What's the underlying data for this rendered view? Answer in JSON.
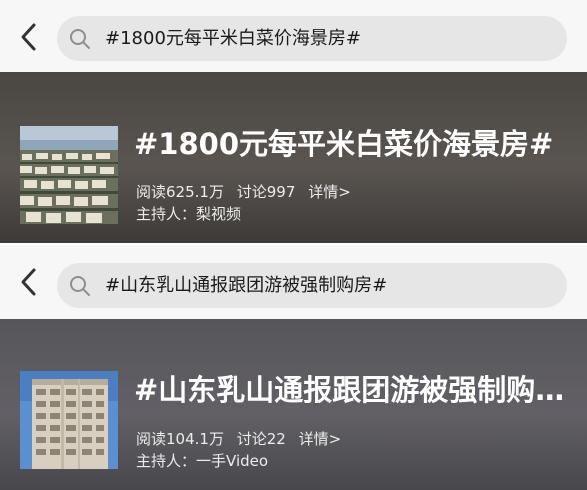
{
  "panels": [
    {
      "search_query": "#1800元每平米白菜价海景房#",
      "title": "#1800元每平米白菜价海景房#",
      "read_label": "阅读",
      "read_count": "625.1万",
      "discuss_label": "讨论",
      "discuss_count": "997",
      "detail_label": "详情>",
      "host_label": "主持人：",
      "host_name": "梨视频",
      "icons": {
        "back": "chevron-left-icon",
        "search": "search-icon"
      }
    },
    {
      "search_query": "#山东乳山通报跟团游被强制购房#",
      "title": "#山东乳山通报跟团游被强制购…",
      "read_label": "阅读",
      "read_count": "104.1万",
      "discuss_label": "讨论",
      "discuss_count": "22",
      "detail_label": "详情>",
      "host_label": "主持人：",
      "host_name": "一手Video",
      "icons": {
        "back": "chevron-left-icon",
        "search": "search-icon"
      }
    }
  ],
  "colors": {
    "search_bg": "#e6e6e6",
    "banner_1": "#5a5551",
    "banner_2": "#626066",
    "title_text": "#ffffff"
  }
}
